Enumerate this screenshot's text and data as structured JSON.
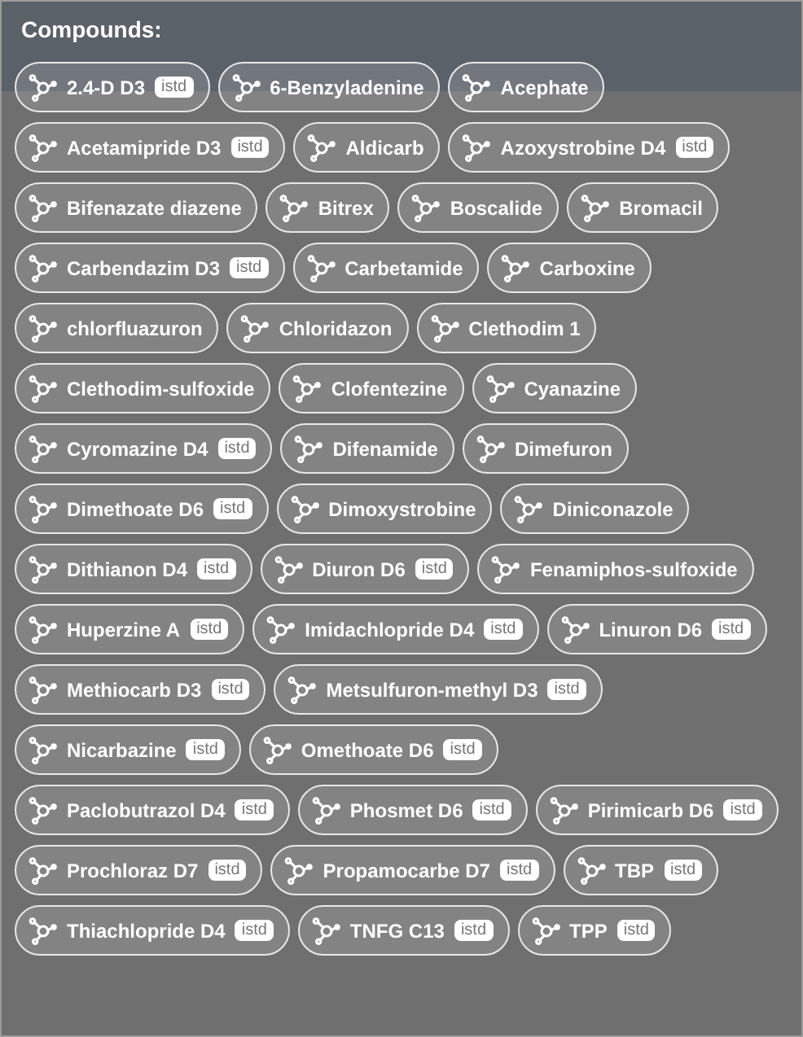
{
  "title": "Compounds:",
  "compounds": [
    {
      "name": "2.4-D D3",
      "badge": "istd"
    },
    {
      "name": "6-Benzyladenine"
    },
    {
      "name": "Acephate"
    },
    {
      "name": "Acetamipride D3",
      "badge": "istd"
    },
    {
      "name": "Aldicarb"
    },
    {
      "name": "Azoxystrobine D4",
      "badge": "istd"
    },
    {
      "name": "Bifenazate diazene"
    },
    {
      "name": "Bitrex"
    },
    {
      "name": "Boscalide"
    },
    {
      "name": "Bromacil"
    },
    {
      "name": "Carbendazim D3",
      "badge": "istd"
    },
    {
      "name": "Carbetamide"
    },
    {
      "name": "Carboxine"
    },
    {
      "name": "chlorfluazuron"
    },
    {
      "name": "Chloridazon"
    },
    {
      "name": "Clethodim 1"
    },
    {
      "name": "Clethodim-sulfoxide"
    },
    {
      "name": "Clofentezine"
    },
    {
      "name": "Cyanazine"
    },
    {
      "name": "Cyromazine D4",
      "badge": "istd"
    },
    {
      "name": "Difenamide"
    },
    {
      "name": "Dimefuron"
    },
    {
      "name": "Dimethoate D6",
      "badge": "istd"
    },
    {
      "name": "Dimoxystrobine"
    },
    {
      "name": "Diniconazole"
    },
    {
      "name": "Dithianon D4",
      "badge": "istd"
    },
    {
      "name": "Diuron D6",
      "badge": "istd"
    },
    {
      "name": "Fenamiphos-sulfoxide"
    },
    {
      "name": "Huperzine A",
      "badge": "istd"
    },
    {
      "name": "Imidachlopride D4",
      "badge": "istd"
    },
    {
      "name": "Linuron D6",
      "badge": "istd"
    },
    {
      "name": "Methiocarb D3",
      "badge": "istd"
    },
    {
      "name": "Metsulfuron-methyl D3",
      "badge": "istd"
    },
    {
      "name": "Nicarbazine",
      "badge": "istd"
    },
    {
      "name": "Omethoate D6",
      "badge": "istd"
    },
    {
      "name": "Paclobutrazol D4",
      "badge": "istd"
    },
    {
      "name": "Phosmet D6",
      "badge": "istd"
    },
    {
      "name": "Pirimicarb D6",
      "badge": "istd"
    },
    {
      "name": "Prochloraz D7",
      "badge": "istd"
    },
    {
      "name": "Propamocarbe D7",
      "badge": "istd"
    },
    {
      "name": "TBP",
      "badge": "istd"
    },
    {
      "name": "Thiachlopride D4",
      "badge": "istd"
    },
    {
      "name": "TNFG C13",
      "badge": "istd"
    },
    {
      "name": "TPP",
      "badge": "istd"
    }
  ]
}
